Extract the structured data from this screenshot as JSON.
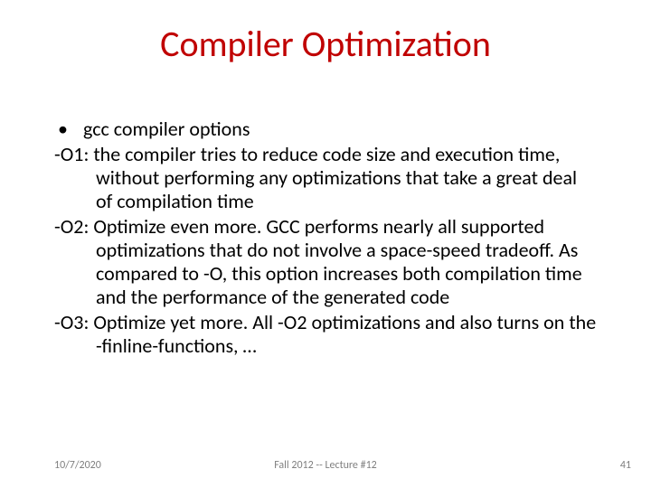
{
  "title": "Compiler Optimization",
  "body": {
    "bullet1": "gcc compiler options",
    "o1": "-O1: the compiler tries to reduce code size and execution time, without performing any optimizations that take a great deal of compilation time",
    "o2": "-O2: Optimize even more. GCC performs nearly all supported optimizations that do not involve a space-speed tradeoff. As compared to -O, this option increases both compilation time and the performance of the generated code",
    "o3": "-O3: Optimize yet more. All -O2 optimizations and also turns on the -finline-functions, …"
  },
  "footer": {
    "date": "10/7/2020",
    "center": "Fall 2012 -- Lecture #12",
    "page": "41"
  }
}
